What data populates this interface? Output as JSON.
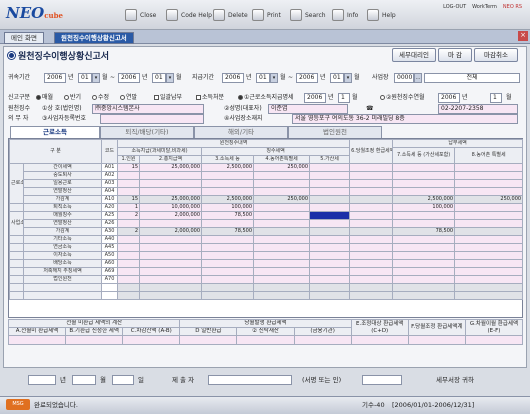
{
  "app": {
    "logo": "NEO",
    "logo_sub": "cube"
  },
  "toolbar": {
    "close": "Close",
    "code_help": "Code Help",
    "delete": "Delete",
    "print": "Print",
    "search": "Search",
    "info": "Info",
    "help": "Help"
  },
  "top_links": [
    "LOG-OUT",
    "WorkTerm",
    "NEO RS"
  ],
  "tabs": [
    {
      "label": "메인 화면"
    },
    {
      "label": "원천징수이행상황신고서"
    }
  ],
  "form": {
    "title": "원천징수이행상황신고서"
  },
  "buttons": {
    "tax_agent": "세무대리인",
    "close_month": "마 감",
    "cancel_close": "마감취소"
  },
  "period": {
    "label_attr": "귀속기간",
    "attr_from_year": "2006",
    "attr_from_month": "01",
    "attr_to_year": "2006",
    "attr_to_month": "01",
    "label_pay": "지급기간",
    "pay_from_year": "2006",
    "pay_from_month": "01",
    "pay_to_year": "2006",
    "pay_to_month": "01",
    "year_suffix": "년",
    "month_suffix": "월",
    "tilde": "~",
    "label_site": "사업장",
    "site_code": "0000",
    "site_name": "전체"
  },
  "report": {
    "label": "신고구분",
    "opts": [
      "매월",
      "반기",
      "수정",
      "연말"
    ],
    "selected_index": 0,
    "chk_batch": "일괄납부",
    "chk_unit": "소득처분",
    "radio_transfer": "①근로소득지급명세",
    "transfer_year": "2006",
    "transfer_month": "1",
    "radio_paid": "②원천징수연월",
    "paid_year": "2006",
    "paid_month": "1"
  },
  "payer": {
    "label1": "원천징수",
    "label2": "의 무 자",
    "corp_label": "①상 호(법인명)",
    "corp_name": "㈜중앙시스템본사",
    "rep_label": "②성명(대표자)",
    "rep_name": "이준엽",
    "phone": "02-2207-2358",
    "bizno_label": "③사업자등록번호",
    "addr_label": "④사업장소재지",
    "addr": "서울 영등포구 여의도동 36-2 미래빌딩 8층"
  },
  "subtabs": [
    "근로소득",
    "퇴직/배당(기타)",
    "해외/기타",
    "법인원천"
  ],
  "grid": {
    "h_group": "구 분",
    "h_code": "코드",
    "h_withhold": "원천징수내역",
    "h_income": "소득지급(과세미달,비과세)",
    "h_tax": "징수세액",
    "h_adj": "6.당월조정\n환급세액",
    "h_pay": "납부세액",
    "h_cols": [
      "1.인원",
      "2.총지급액",
      "3.소득세 등",
      "4.농어촌특별세",
      "5.가산세",
      "7.소득세 등\n(가산세포함)",
      "8.농어촌\n특별세"
    ],
    "cat_labor": "근로소득",
    "cat_biz": "사업소득",
    "rows": [
      {
        "name": "간이세액",
        "code": "A01",
        "p": "15",
        "amt": "25,000,000",
        "tax": "2,500,000",
        "rt": "250,000",
        "add": "",
        "adj": "",
        "paytax": "",
        "payrt": "",
        "cls": "pink"
      },
      {
        "name": "중도퇴사",
        "code": "A02",
        "p": "",
        "amt": "",
        "tax": "",
        "rt": "",
        "add": "",
        "adj": "",
        "paytax": "",
        "payrt": "",
        "cls": "pink"
      },
      {
        "name": "일용근로",
        "code": "A03",
        "p": "",
        "amt": "",
        "tax": "",
        "rt": "",
        "add": "",
        "adj": "",
        "paytax": "",
        "payrt": "",
        "cls": "pink"
      },
      {
        "name": "연말정산",
        "code": "A04",
        "p": "",
        "amt": "",
        "tax": "",
        "rt": "",
        "add": "",
        "adj": "",
        "paytax": "",
        "payrt": "",
        "cls": "pink"
      },
      {
        "name": "가감계",
        "code": "A10",
        "p": "15",
        "amt": "25,000,000",
        "tax": "2,500,000",
        "rt": "250,000",
        "add": "",
        "adj": "",
        "paytax": "2,500,000",
        "payrt": "250,000",
        "cls": "gray"
      },
      {
        "name": "퇴직소득",
        "code": "A20",
        "p": "1",
        "amt": "10,000,000",
        "tax": "100,000",
        "rt": "",
        "add": "",
        "adj": "",
        "paytax": "100,000",
        "payrt": "",
        "cls": "pink"
      },
      {
        "name": "매월징수",
        "code": "A25",
        "p": "2",
        "amt": "2,000,000",
        "tax": "78,500",
        "rt": "",
        "add": "sel",
        "adj": "",
        "paytax": "",
        "payrt": "",
        "cls": "pink"
      },
      {
        "name": "연말정산",
        "code": "A26",
        "p": "",
        "amt": "",
        "tax": "",
        "rt": "",
        "add": "",
        "adj": "",
        "paytax": "",
        "payrt": "",
        "cls": "pink"
      },
      {
        "name": "가감계",
        "code": "A30",
        "p": "2",
        "amt": "2,000,000",
        "tax": "78,500",
        "rt": "",
        "add": "",
        "adj": "",
        "paytax": "78,500",
        "payrt": "",
        "cls": "gray"
      },
      {
        "name": "기타소득",
        "code": "A40",
        "p": "",
        "amt": "",
        "tax": "",
        "rt": "",
        "add": "",
        "adj": "",
        "paytax": "",
        "payrt": "",
        "cls": "pink"
      },
      {
        "name": "연금소득",
        "code": "A45",
        "p": "",
        "amt": "",
        "tax": "",
        "rt": "",
        "add": "",
        "adj": "",
        "paytax": "",
        "payrt": "",
        "cls": "pink"
      },
      {
        "name": "이자소득",
        "code": "A50",
        "p": "",
        "amt": "",
        "tax": "",
        "rt": "",
        "add": "",
        "adj": "",
        "paytax": "",
        "payrt": "",
        "cls": "pink"
      },
      {
        "name": "배당소득",
        "code": "A60",
        "p": "",
        "amt": "",
        "tax": "",
        "rt": "",
        "add": "",
        "adj": "",
        "paytax": "",
        "payrt": "",
        "cls": "pink"
      },
      {
        "name": "저축해지 추징세액",
        "code": "A69",
        "p": "",
        "amt": "",
        "tax": "",
        "rt": "",
        "add": "",
        "adj": "",
        "paytax": "",
        "payrt": "",
        "cls": "pink"
      },
      {
        "name": "법인원천",
        "code": "A70",
        "p": "",
        "amt": "",
        "tax": "",
        "rt": "",
        "add": "",
        "adj": "",
        "paytax": "",
        "payrt": "",
        "cls": "pink"
      },
      {
        "name": "",
        "code": "",
        "p": "",
        "amt": "",
        "tax": "",
        "rt": "",
        "add": "",
        "adj": "",
        "paytax": "",
        "payrt": "",
        "cls": "gray"
      },
      {
        "name": "",
        "code": "",
        "p": "",
        "amt": "",
        "tax": "",
        "rt": "",
        "add": "",
        "adj": "",
        "paytax": "",
        "payrt": "",
        "cls": "gray"
      }
    ]
  },
  "refund": {
    "h1": "전월 미환급 세액의 계산",
    "h2": "당월발생 환급세액",
    "h3": "E.조정대상\n환급세액\n(C+D)",
    "h4": "F.당월조정\n환급세액계",
    "h5": "G.차월이월\n환급세액\n(E-F)",
    "cols": [
      "A.전월미\n환급세액",
      "B.기환급\n신청한 세액",
      "C.차감잔액\n(A-B)",
      "D\n일반환급",
      "②\n신탁재산",
      "(금융기관)"
    ]
  },
  "footer": {
    "year_suffix": "년",
    "month_suffix": "월",
    "day_suffix": "일",
    "submitter": "제 출 자",
    "sign": "(서명 또는 인)",
    "agent": "세무서장 귀하"
  },
  "status": {
    "message": "완료되었습니다.",
    "term": "기수-40",
    "range": "[2006/01/01-2006/12/31]"
  }
}
